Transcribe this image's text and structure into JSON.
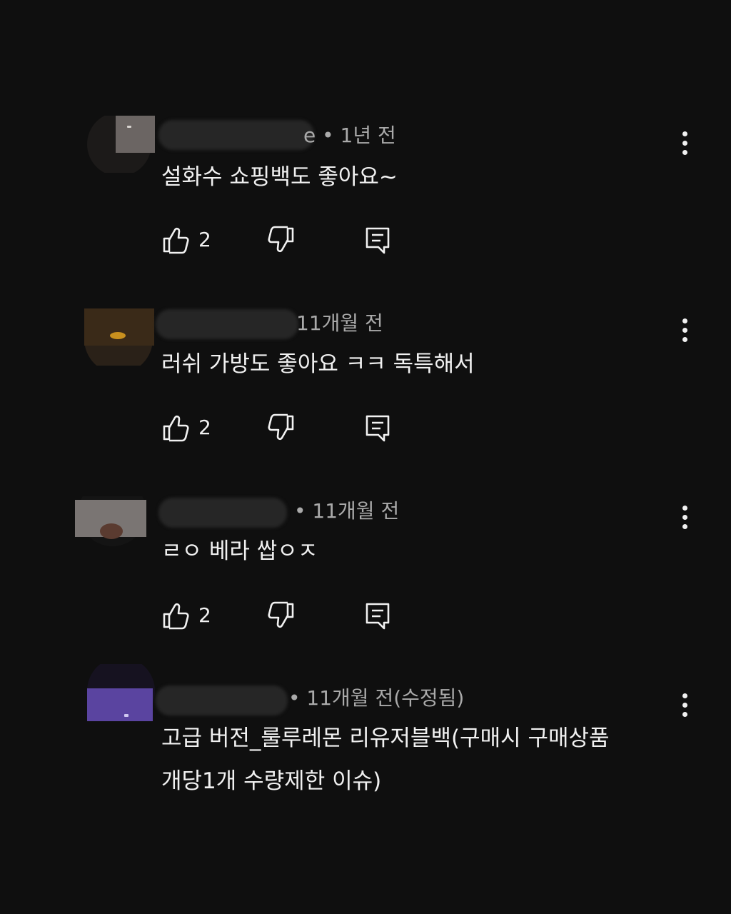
{
  "comments": [
    {
      "meta": "e • 1년 전",
      "text": "설화수 쇼핑백도  좋아요~",
      "likes": "2",
      "like_icon": "thumbs-up-icon",
      "dislike_icon": "thumbs-down-icon",
      "reply_icon": "reply-icon",
      "more_icon": "more-vert-icon"
    },
    {
      "meta": "11개월 전",
      "text": "러쉬 가방도 좋아요 ㅋㅋ 독특해서",
      "likes": "2",
      "like_icon": "thumbs-up-icon",
      "dislike_icon": "thumbs-down-icon",
      "reply_icon": "reply-icon",
      "more_icon": "more-vert-icon"
    },
    {
      "meta": "• 11개월 전",
      "text": "ㄹㅇ 베라 쌉ㅇㅈ",
      "likes": "2",
      "like_icon": "thumbs-up-icon",
      "dislike_icon": "thumbs-down-icon",
      "reply_icon": "reply-icon",
      "more_icon": "more-vert-icon"
    },
    {
      "meta": "• 11개월 전(수정됨)",
      "text_line1": "고급 버전_룰루레몬 리유저블백(구매시 구매상품",
      "text_line2": "개당1개 수량제한 이슈)",
      "more_icon": "more-vert-icon"
    }
  ],
  "colors": {
    "background": "#0f0f0f",
    "primary_text": "#f1f1f1",
    "secondary_text": "#aaaaaa"
  }
}
